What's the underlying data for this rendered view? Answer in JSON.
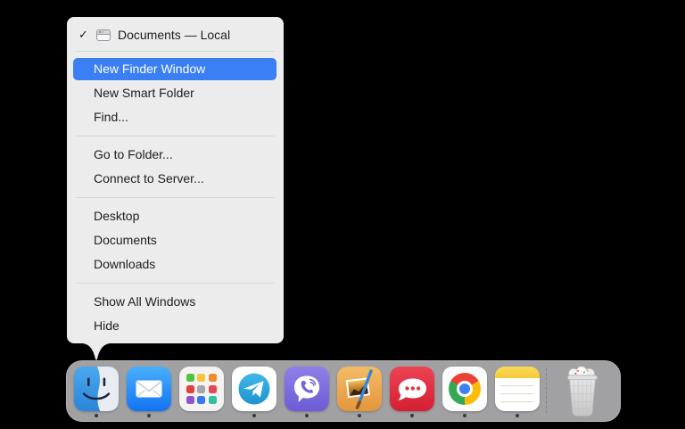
{
  "menu": {
    "header": {
      "checkmark": "✓",
      "icon": "finder-window-icon",
      "label": "Documents — Local"
    },
    "sections": [
      {
        "items": [
          {
            "label": "New Finder Window",
            "highlighted": true
          },
          {
            "label": "New Smart Folder",
            "highlighted": false
          },
          {
            "label": "Find...",
            "highlighted": false
          }
        ]
      },
      {
        "items": [
          {
            "label": "Go to Folder...",
            "highlighted": false
          },
          {
            "label": "Connect to Server...",
            "highlighted": false
          }
        ]
      },
      {
        "items": [
          {
            "label": "Desktop",
            "highlighted": false
          },
          {
            "label": "Documents",
            "highlighted": false
          },
          {
            "label": "Downloads",
            "highlighted": false
          }
        ]
      },
      {
        "items": [
          {
            "label": "Show All Windows",
            "highlighted": false
          },
          {
            "label": "Hide",
            "highlighted": false
          }
        ]
      }
    ],
    "colors": {
      "background": "#ececec",
      "highlight": "#3b7ff5",
      "text": "#1d1d1f",
      "highlight_text": "#ffffff",
      "separator": "#d7d7d7"
    }
  },
  "dock": {
    "apps": [
      {
        "name": "Finder",
        "running": true
      },
      {
        "name": "Mail",
        "running": true
      },
      {
        "name": "Launchpad",
        "running": false
      },
      {
        "name": "Telegram",
        "running": true
      },
      {
        "name": "Viber",
        "running": true
      },
      {
        "name": "Pixelmator",
        "running": true
      },
      {
        "name": "Rocket.Chat",
        "running": true
      },
      {
        "name": "Chrome",
        "running": true
      },
      {
        "name": "Notes",
        "running": true
      }
    ],
    "trash": {
      "name": "Trash",
      "state": "full"
    },
    "colors": {
      "background": "#a1a1a3",
      "running_indicator": "#39393d"
    }
  }
}
